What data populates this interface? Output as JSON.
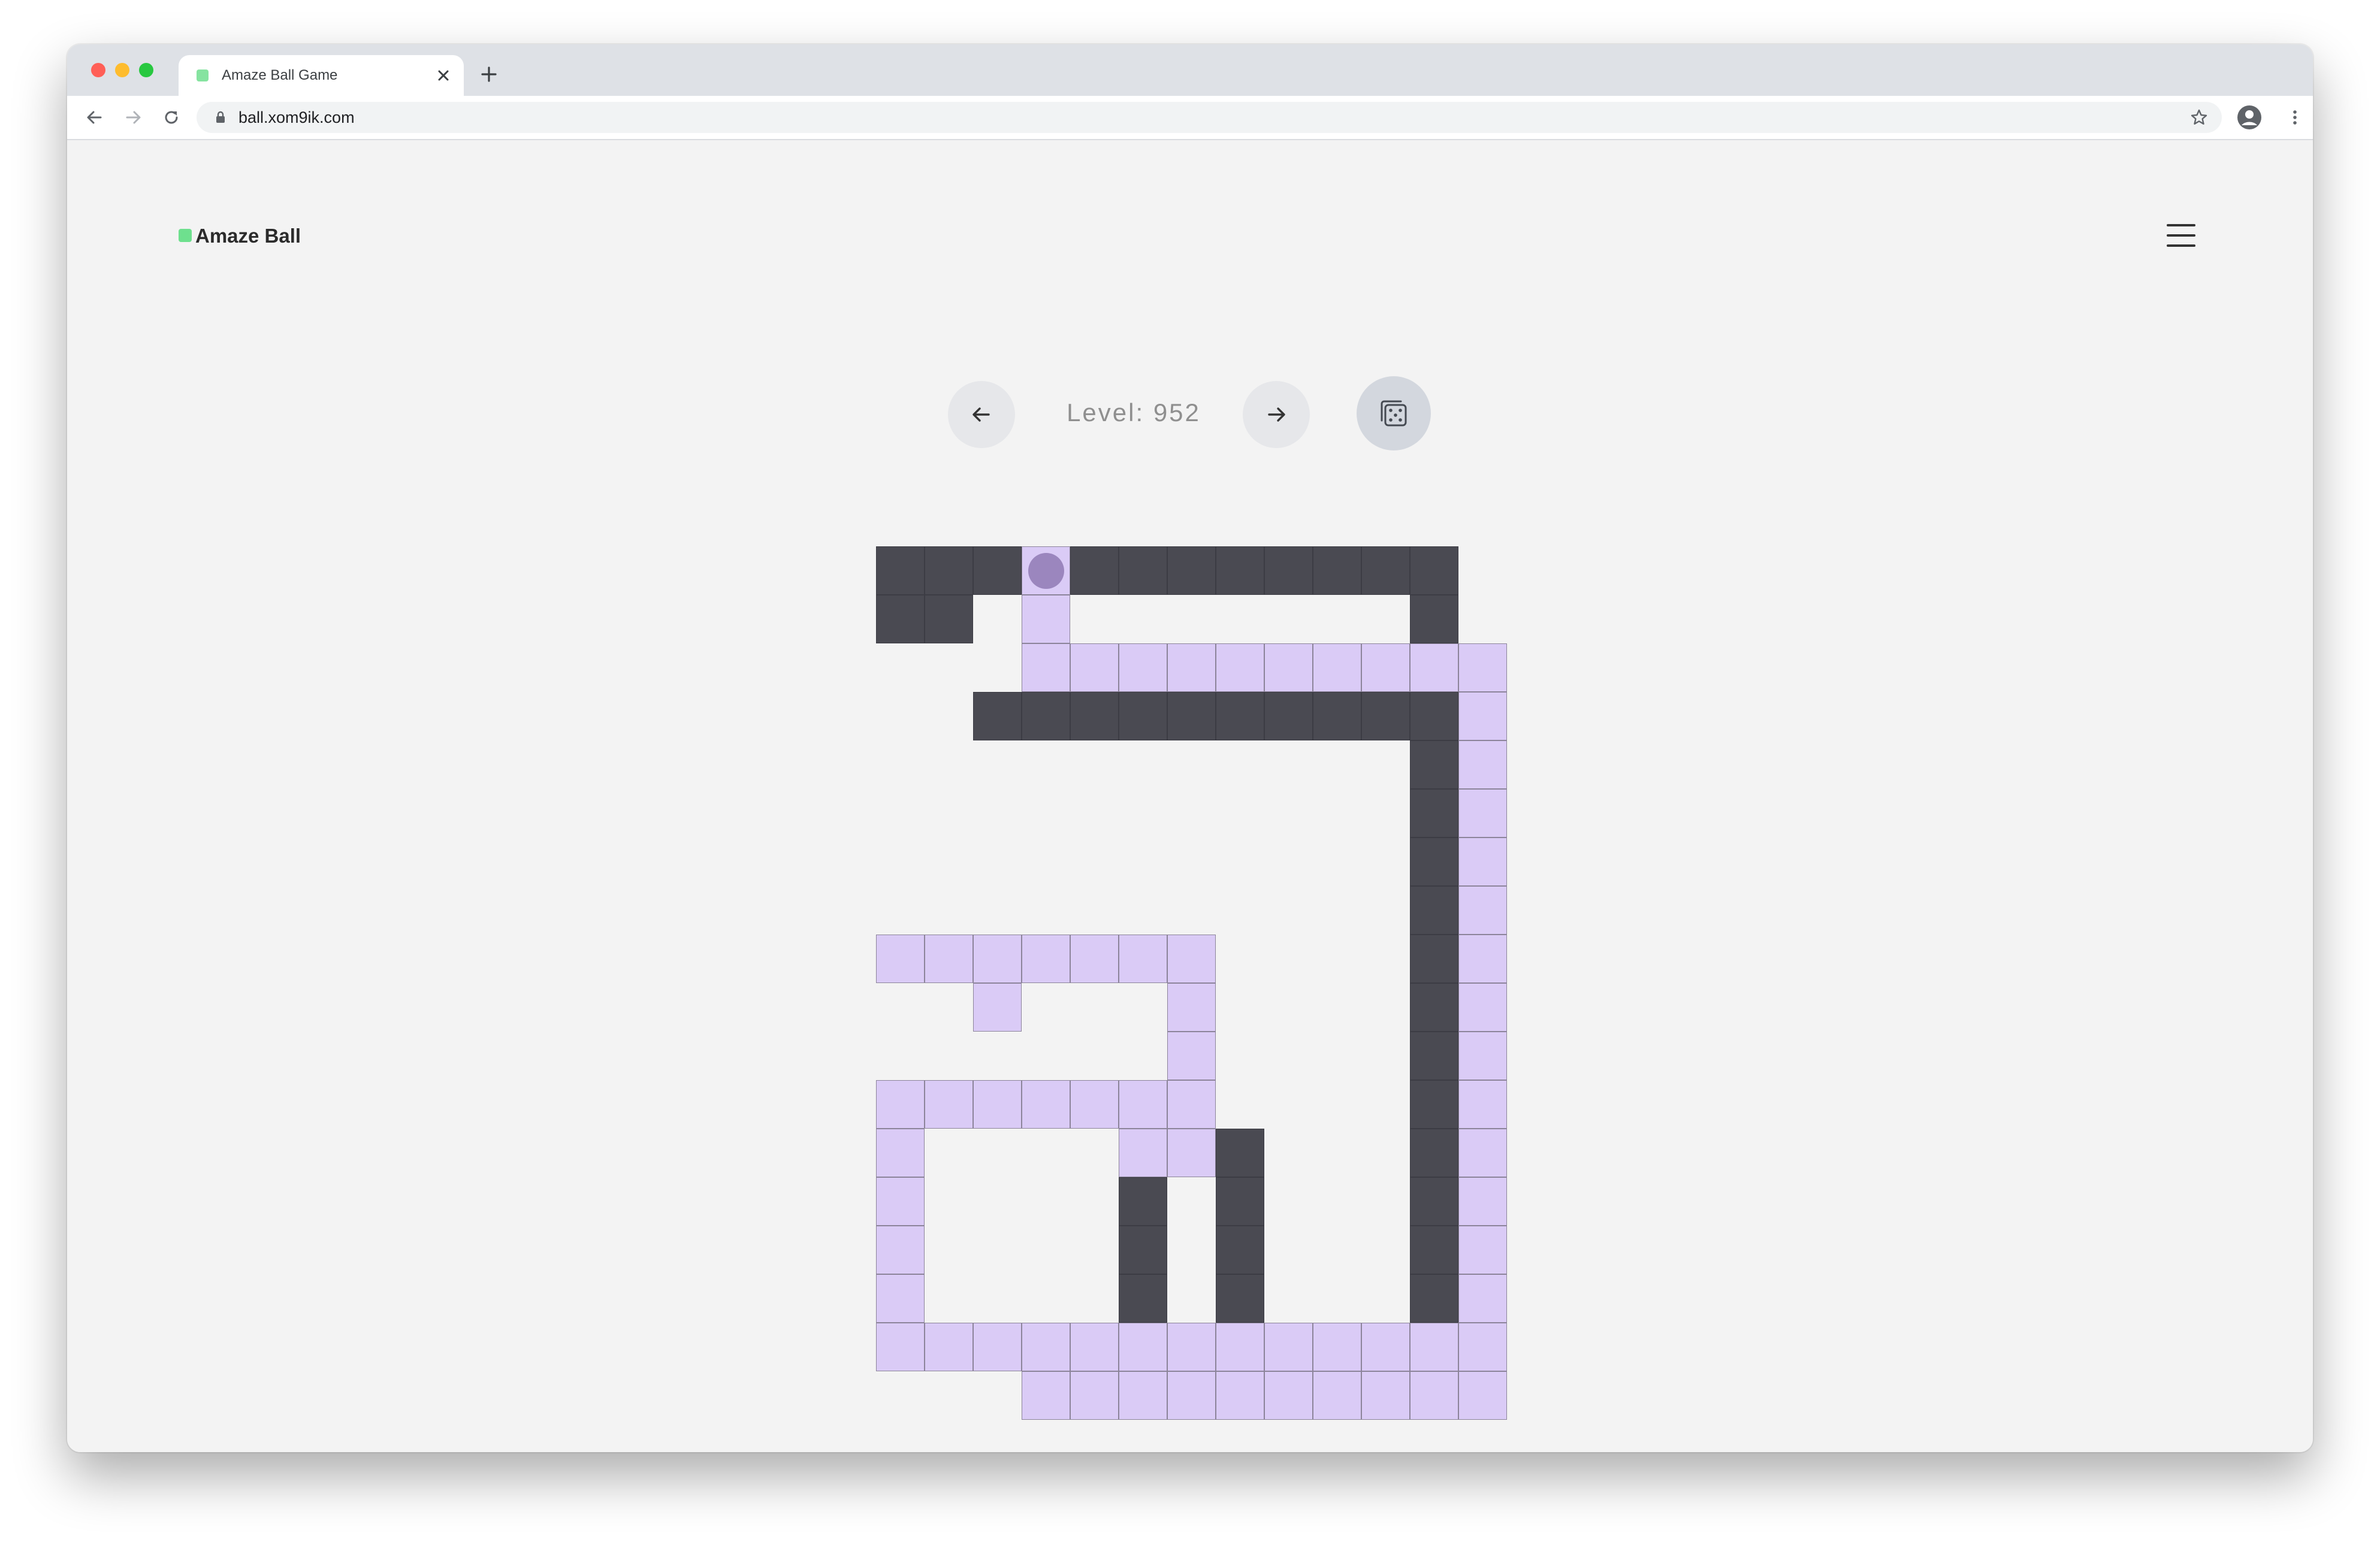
{
  "browser": {
    "tab_title": "Amaze Ball Game",
    "url": "ball.xom9ik.com",
    "tab_favicon_color": "#86e3a0",
    "traffic_lights": [
      "#ff5f57",
      "#febc2e",
      "#28c840"
    ]
  },
  "header": {
    "brand": "Amaze Ball",
    "brand_color": "#6ee08e",
    "menu_icon": "hamburger-menu-icon"
  },
  "controls": {
    "prev_icon": "arrow-left-icon",
    "next_icon": "arrow-right-icon",
    "random_icon": "dice-icon",
    "level_text": "Level: 952"
  },
  "game": {
    "level": 952,
    "columns": 13,
    "rows": 18,
    "colors": {
      "wall": "#4a4a52",
      "painted": "#dacbf6",
      "ball": "#9b86be",
      "floor": "#f3f3f3"
    },
    "ball": {
      "row": 0,
      "col": 3
    },
    "grid": [
      "WWWPWWWWWWWW.",
      "WW.P.......W.",
      "...PPPPPPPPPP",
      "..WWWWWWWWWWP",
      "...........WP",
      "...........WP",
      "...........WP",
      "...........WP",
      "PPPPPPP....WP",
      "..P...P....WP",
      "......P....WP",
      "PPPPPPP....WP",
      "P....PPW...WP",
      "P....W.W...WP",
      "P....W.W...WP",
      "P....W.W...WP",
      "PPPPPPPPPPPPP",
      "...PPPPPPPPPP"
    ]
  }
}
